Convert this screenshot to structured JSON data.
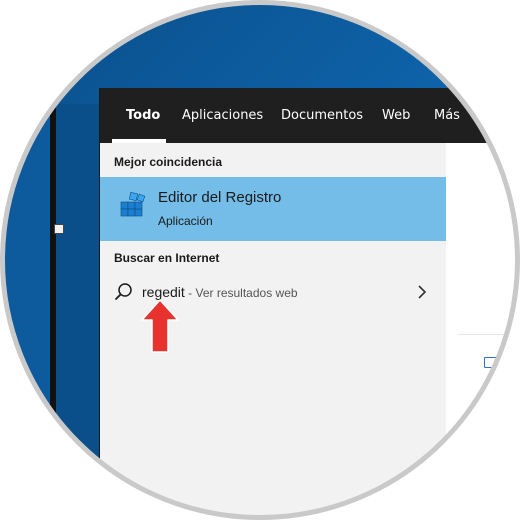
{
  "tabs": [
    {
      "label": "Todo",
      "active": true
    },
    {
      "label": "Aplicaciones",
      "active": false
    },
    {
      "label": "Documentos",
      "active": false
    },
    {
      "label": "Web",
      "active": false
    },
    {
      "label": "Más",
      "active": false
    }
  ],
  "best_match": {
    "section_title": "Mejor coincidencia",
    "app_name": "Editor del Registro",
    "app_type": "Aplicación",
    "icon": "registry-editor-icon",
    "highlight_color": "#74bde8"
  },
  "web_search": {
    "section_title": "Buscar en Internet",
    "query": "regedit",
    "hint": " - Ver resultados web",
    "icon": "search-icon"
  },
  "annotation": {
    "icon": "red-arrow-up-icon",
    "color": "#e8322d"
  }
}
